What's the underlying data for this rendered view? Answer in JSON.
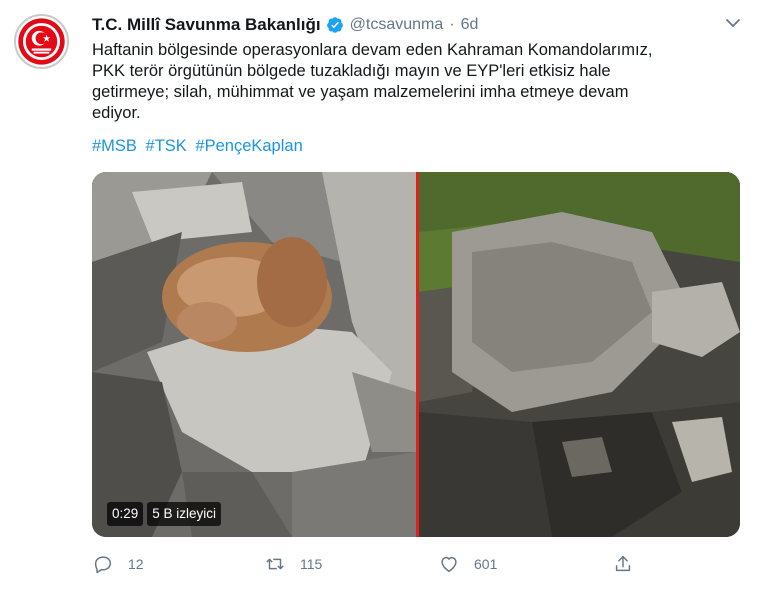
{
  "account": {
    "name": "T.C. Millî Savunma Bakanlığı",
    "handle": "@tcsavunma",
    "separator": "·",
    "time": "6d"
  },
  "tweet": {
    "lines": [
      "Haftanin bölgesinde operasyonlara devam eden Kahraman Komandolarımız,",
      "PKK terör örgütünün bölgede tuzakladığı mayın ve EYP'leri etkisiz hale",
      "getirmeye; silah, mühimmat ve yaşam malzemelerini imha etmeye devam",
      "ediyor."
    ],
    "hashtags": [
      "#MSB",
      "#TSK",
      "#PençeKaplan"
    ]
  },
  "video": {
    "duration": "0:29",
    "views": "5 B izleyici"
  },
  "actions": {
    "replies": "12",
    "retweets": "115",
    "likes": "601"
  },
  "colors": {
    "link": "#1b95e0",
    "muted": "#657786",
    "emblem_red": "#e30a17",
    "divider_red": "#e0201b"
  }
}
